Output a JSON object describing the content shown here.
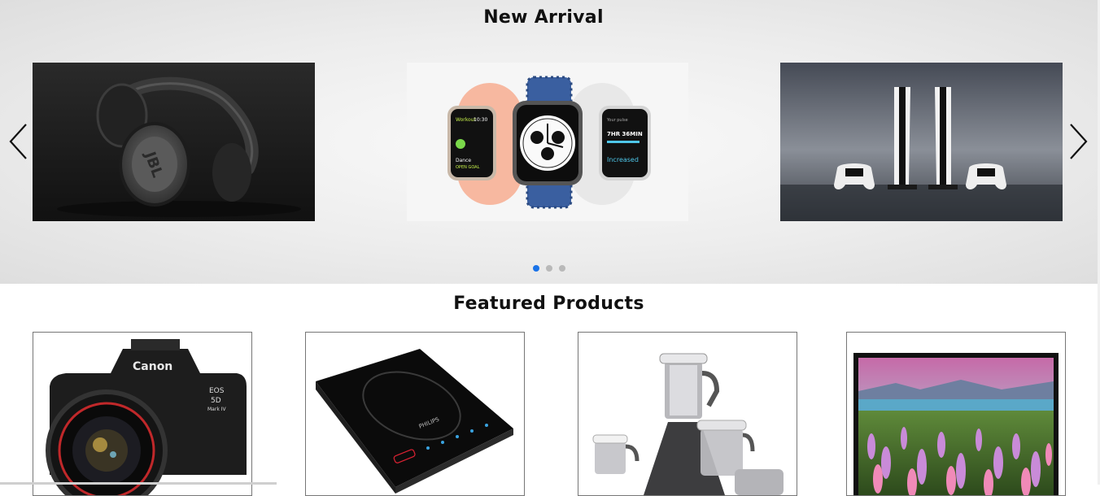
{
  "new_arrival": {
    "title": "New Arrival",
    "slides": [
      {
        "icon": "headphones-icon",
        "brand": "JBL"
      },
      {
        "icon": "smartwatch-icon",
        "watch_left_time": "10:30",
        "watch_left_line1": "Workout",
        "watch_left_line2": "Dance",
        "watch_left_line3": "OPEN GOAL",
        "watch_right_line1": "Your pulse",
        "watch_right_line2": "7HR 36MIN",
        "watch_right_line3": "Increased"
      },
      {
        "icon": "game-console-icon"
      }
    ],
    "dots_total": 3,
    "active_dot": 1,
    "accent_color": "#1a73e8"
  },
  "featured": {
    "title": "Featured Products",
    "products": [
      {
        "icon": "camera-icon",
        "brand": "Canon",
        "model": "EOS",
        "model2": "5D",
        "model3": "Mark IV"
      },
      {
        "icon": "induction-cooktop-icon",
        "brand": "PHILIPS"
      },
      {
        "icon": "mixer-grinder-icon"
      },
      {
        "icon": "television-icon"
      }
    ]
  }
}
